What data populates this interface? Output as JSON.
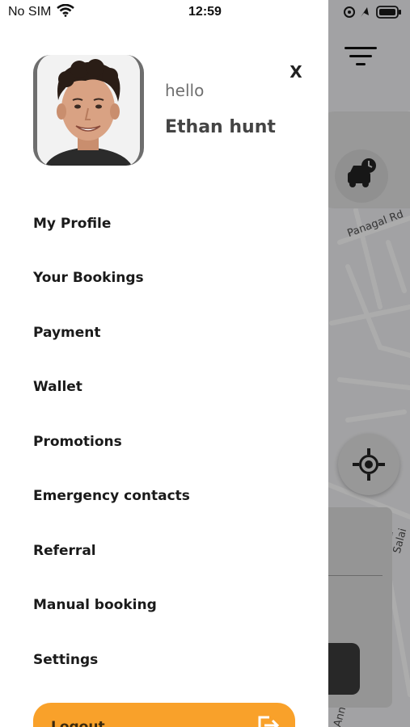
{
  "status_bar": {
    "carrier": "No SIM",
    "time": "12:59"
  },
  "drawer": {
    "greeting": "hello",
    "user_name": "Ethan hunt",
    "close_label": "X",
    "menu": [
      {
        "label": "My Profile"
      },
      {
        "label": "Your Bookings"
      },
      {
        "label": "Payment"
      },
      {
        "label": "Wallet"
      },
      {
        "label": "Promotions"
      },
      {
        "label": "Emergency contacts"
      },
      {
        "label": "Referral"
      },
      {
        "label": "Manual booking"
      },
      {
        "label": "Settings"
      }
    ],
    "logout_label": "Logout"
  },
  "map": {
    "road_label_1": "Panagal Rd",
    "road_label_2": "nna Salai",
    "road_label_3": "Ann"
  },
  "colors": {
    "accent": "#f9a12a",
    "drawer_bg": "#ffffff",
    "text": "#1a1a1a"
  },
  "icons": {
    "wifi": "wifi-icon",
    "close": "close-icon",
    "filter": "filter-icon",
    "car_schedule": "car-clock-icon",
    "locate": "locate-icon",
    "logout": "logout-icon"
  }
}
